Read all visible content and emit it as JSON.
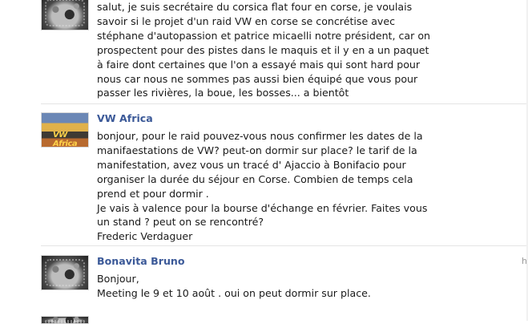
{
  "posts": [
    {
      "author": "",
      "text": "salut, je suis secrétaire du corsica flat four en corse, je voulais\nsavoir si le projet d'un raid VW en corse se concrétise avec\nstéphane d'autopassion et patrice micaelli notre président, car on\nprospectent pour des pistes dans le maquis et il y en a un paquet\nà faire dont certaines que l'on a essayé mais qui sont hard pour\nnous car nous ne sommes pas aussi bien équipé que vous pour\npasser les rivières, la boue, les bosses... a bientôt"
    },
    {
      "author": "VW Africa",
      "avatar_text": "VW Africa",
      "text": "bonjour, pour le raid pouvez-vous nous confirmer les dates de la\nmanifaestations de VW? peut-on dormir sur place? le tarif de la\nmanifestation, avez vous un tracé d' Ajaccio à Bonifacio pour\norganiser la durée du séjour en Corse. Combien de temps cela\nprend et pour dormir .\nJe vais à valence pour la bourse d'échange en février. Faites vous\nun stand ? peut on se rencontré?\nFrederic Verdaguer"
    },
    {
      "author": "Bonavita Bruno",
      "text": "Bonjour,\nMeeting le 9 et 10 août . oui on peut dormir sur place."
    }
  ],
  "timestamp_fragment": "h"
}
